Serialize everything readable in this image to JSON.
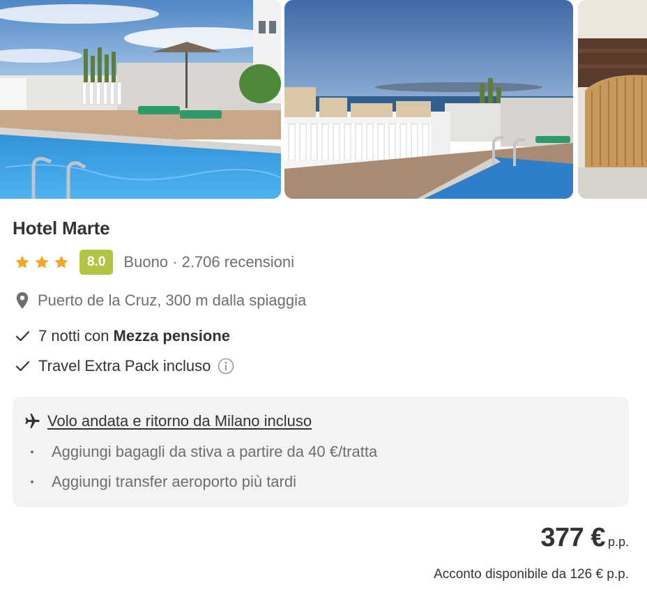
{
  "gallery": {
    "photos": [
      {
        "icon": "hotel-rooftop-pool-photo"
      },
      {
        "icon": "hotel-terrace-sea-view-photo"
      },
      {
        "icon": "hotel-room-bed-photo"
      }
    ]
  },
  "hotel": {
    "name": "Hotel Marte",
    "stars": 3,
    "star_color": "#f5a623",
    "score": "8.0",
    "score_color": "#b3c442",
    "review_text": "Buono · 2.706 recensioni",
    "location": "Puerto de la Cruz, 300 m dalla spiaggia"
  },
  "features": [
    {
      "text": "7 notti con",
      "strong": "Mezza pensione",
      "icon": "check-icon"
    },
    {
      "text": "Travel Extra Pack incluso",
      "icon": "check-icon",
      "info_icon": "info-icon"
    }
  ],
  "flight": {
    "title": "Volo andata e ritorno da Milano incluso",
    "icon": "plane-icon",
    "items": [
      "Aggiungi bagagli da stiva a partire da 40 €/tratta",
      "Aggiungi transfer aeroporto più tardi"
    ]
  },
  "price": {
    "value": "377 €",
    "unit": "p.p.",
    "deposit": "Acconto disponibile da 126 € p.p."
  }
}
